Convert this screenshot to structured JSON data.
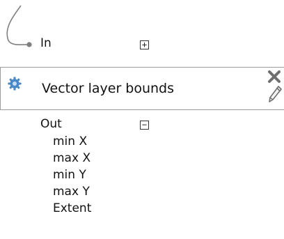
{
  "input_port": {
    "label": "In",
    "toggle": "+"
  },
  "algorithm": {
    "title": "Vector layer bounds",
    "icon": "gear-icon",
    "remove_icon": "close-icon",
    "edit_icon": "pencil-icon"
  },
  "output_port": {
    "label": "Out",
    "toggle": "−",
    "items": [
      "min X",
      "max X",
      "min Y",
      "max Y",
      "Extent"
    ]
  },
  "colors": {
    "border": "#9b9b9b",
    "gear": "#4a88c7",
    "connector": "#808080"
  }
}
